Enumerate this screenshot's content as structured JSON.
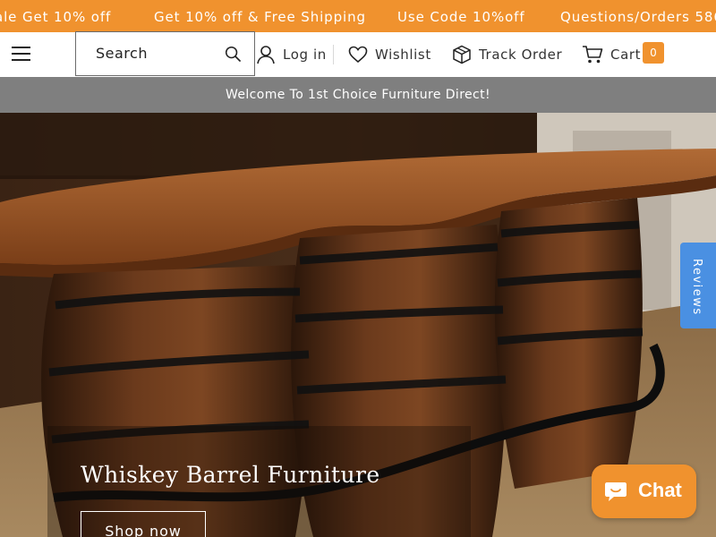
{
  "announcement_bar": {
    "items": [
      "ale Get 10% off",
      "Get 10% off & Free Shipping",
      "Use Code 10%off",
      "Questions/Orders 586"
    ]
  },
  "header": {
    "search": {
      "placeholder": "Search"
    },
    "nav": {
      "login_label": "Log in",
      "wishlist_label": "Wishlist",
      "track_label": "Track Order",
      "cart_label": "Cart",
      "cart_count": "0"
    }
  },
  "welcome_bar": {
    "text": "Welcome To 1st Choice Furniture Direct!"
  },
  "hero": {
    "title": "Whiskey Barrel Furniture",
    "button_label": "Shop now"
  },
  "reviews_tab": {
    "label": "Reviews"
  },
  "chat_widget": {
    "label": "Chat"
  },
  "colors": {
    "accent": "#f0922e",
    "welcome_bg": "#7f7f7f",
    "reviews_tab": "#4a90e2"
  },
  "icons": [
    "menu-icon",
    "search-icon",
    "user-icon",
    "heart-icon",
    "box-icon",
    "cart-icon",
    "chat-icon"
  ]
}
